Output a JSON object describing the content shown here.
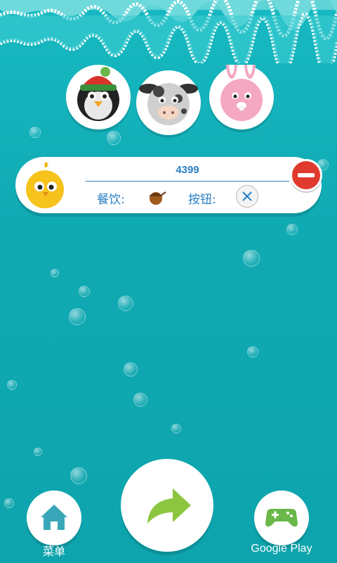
{
  "scene": {
    "characters": [
      {
        "name": "penguin-avatar"
      },
      {
        "name": "cow-avatar"
      },
      {
        "name": "rabbit-avatar"
      }
    ]
  },
  "card": {
    "score": "4399",
    "food_label": "餐饮:",
    "food_icon": "acorn-icon",
    "button_label": "按钮:",
    "button_icon": "close-icon",
    "remove_icon": "minus-icon"
  },
  "bottom": {
    "menu_label": "菜单",
    "play_label": "Google Play",
    "share_icon": "arrow-right-icon",
    "home_icon": "home-icon",
    "controller_icon": "gamepad-icon"
  },
  "colors": {
    "sea": "#10aab3",
    "accent_blue": "#2a7fc4",
    "remove_red": "#e03a2f",
    "arrow_green": "#8cc63f"
  }
}
